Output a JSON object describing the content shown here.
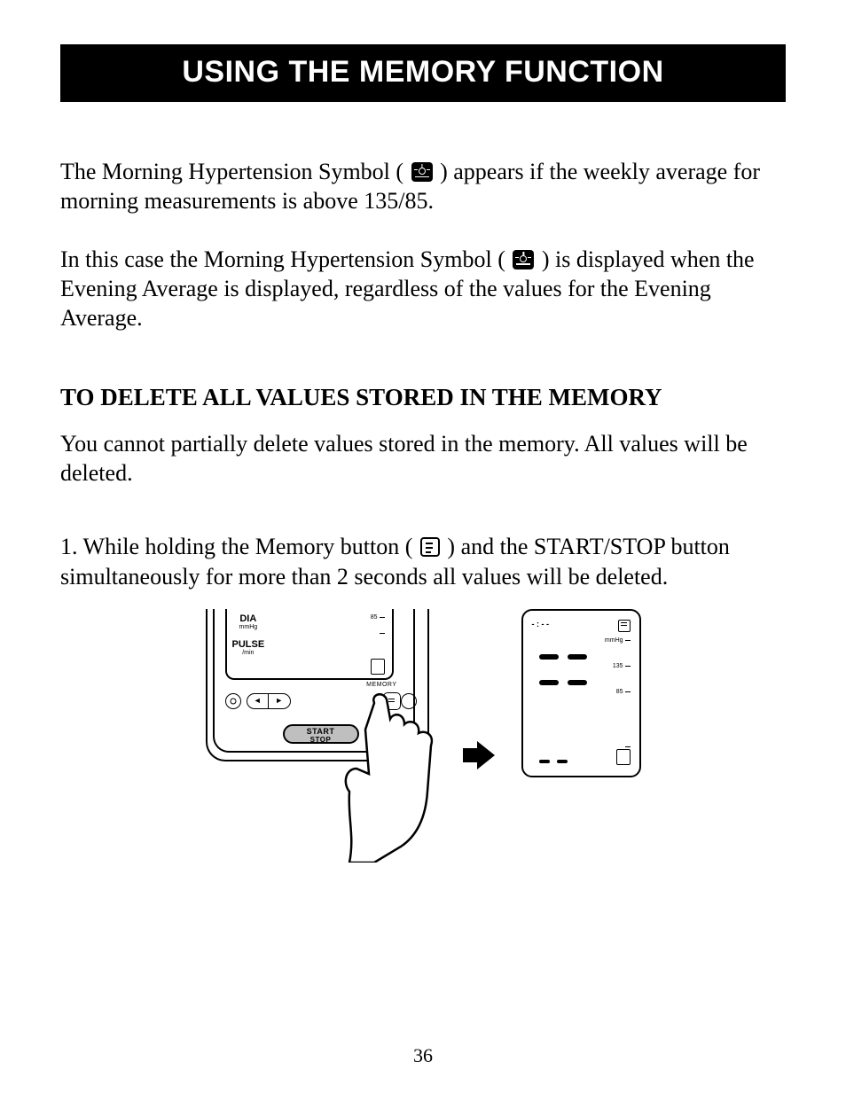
{
  "header": {
    "title": "USING THE MEMORY FUNCTION"
  },
  "paragraphs": {
    "p1a": "The Morning Hypertension Symbol (",
    "p1b": ") appears if the weekly average for morning measurements is above 135/85.",
    "p2a": "In this case the Morning Hypertension Symbol (",
    "p2b": ") is displayed when the Evening Average is displayed, regardless of the values for the Evening Average."
  },
  "section": {
    "heading": "TO DELETE ALL VALUES STORED IN THE MEMORY",
    "intro": "You cannot partially delete values stored in the memory. All values will be deleted."
  },
  "step1": {
    "num": "1.",
    "a": " While holding the Memory button (",
    "b": ") and the START/STOP button simultaneously for more than 2 seconds all values will be deleted."
  },
  "device": {
    "dia": "DIA",
    "dia_unit": "mmHg",
    "pulse": "PULSE",
    "pulse_unit": "/min",
    "memory_label": "MEMORY",
    "start": "START",
    "stop": "STOP",
    "left_arrow": "◄",
    "right_arrow": "►",
    "tick85": "85"
  },
  "lcd": {
    "time": "- : - -",
    "unit": "mmHg",
    "tick135": "135",
    "tick85": "85"
  },
  "page_number": "36"
}
